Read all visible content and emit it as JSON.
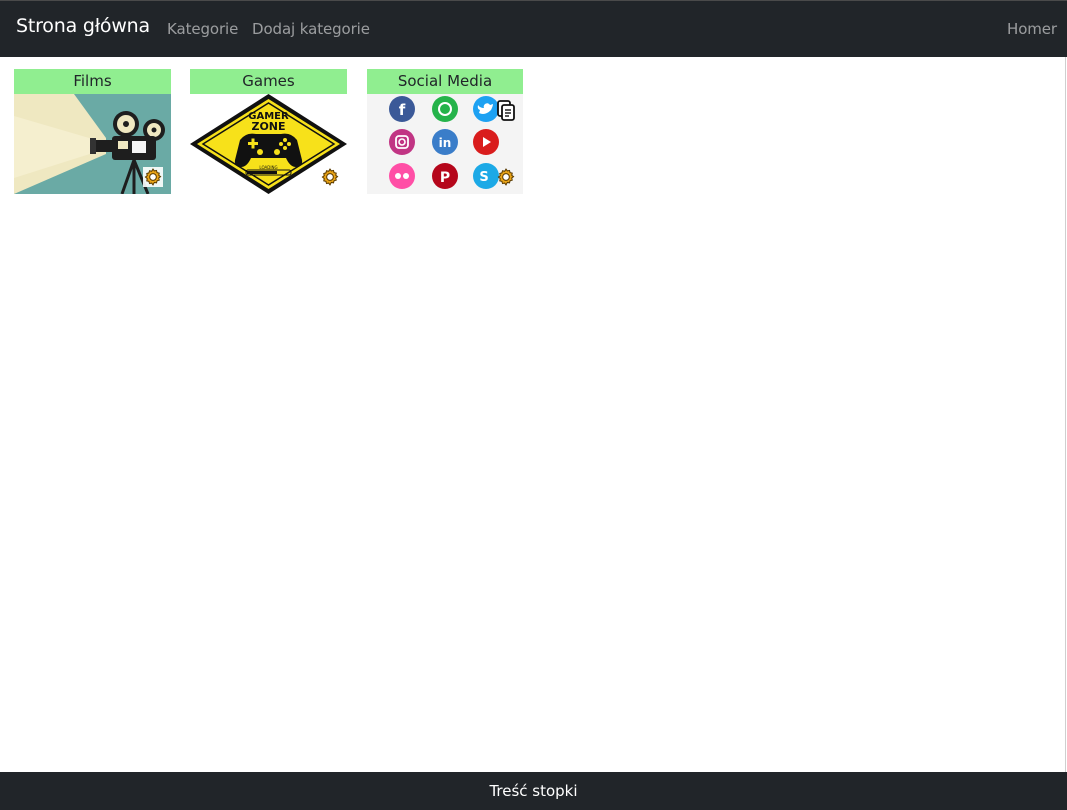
{
  "navbar": {
    "brand": "Strona główna",
    "links": [
      {
        "label": "Kategorie"
      },
      {
        "label": "Dodaj kategorie"
      }
    ],
    "user": "Homer"
  },
  "categories": [
    {
      "title": "Films",
      "image": "vintage-movie-camera-projector"
    },
    {
      "title": "Games",
      "image": "gamer-zone-controller-sign",
      "image_text": [
        "GAMER",
        "ZONE",
        "LOADING"
      ]
    },
    {
      "title": "Social Media",
      "image": "social-media-icons-grid"
    }
  ],
  "footer": {
    "text": "Treść stopki"
  },
  "colors": {
    "navbar_bg": "#212529",
    "card_title_bg": "#90ee90",
    "gear": "#e8a317"
  }
}
